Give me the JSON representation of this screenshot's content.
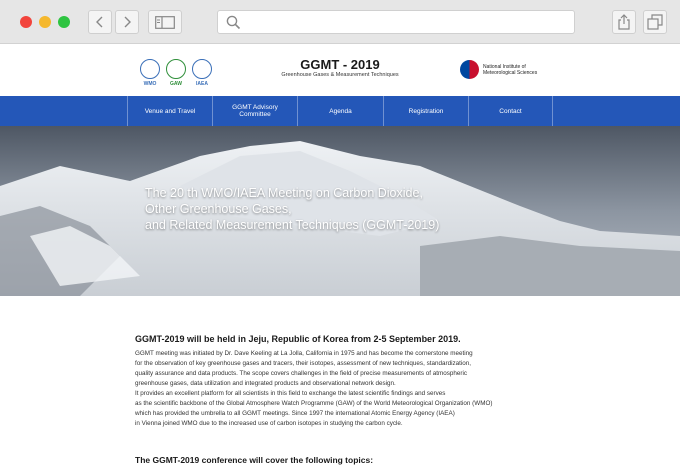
{
  "browser": {
    "icons": [
      "back-icon",
      "forward-icon",
      "sidebar-icon",
      "search-icon",
      "share-icon",
      "tabs-icon"
    ]
  },
  "header": {
    "logos": [
      "WMO",
      "GAW",
      "IAEA"
    ],
    "title": "GGMT - 2019",
    "subtitle": "Greenhouse Gases & Measurement Techniques",
    "institute_line1": "National Institute of",
    "institute_line2": "Meteorological Sciences"
  },
  "nav": {
    "venue": "Venue and Travel",
    "committee_line1": "GGMT Advisory",
    "committee_line2": "Committee",
    "agenda": "Agenda",
    "registration": "Registration",
    "contact": "Contact",
    "bar_color": "#2457b8"
  },
  "hero": {
    "line1": "The 20 th WMO/IAEA Meeting on Carbon Dioxide,",
    "line2": "Other Greenhouse Gases,",
    "line3": "and Related Measurement Techniques (GGMT-2019)"
  },
  "content": {
    "headline": "GGMT-2019 will be held in Jeju, Republic of Korea from 2-5 September 2019.",
    "lines": [
      "GGMT meeting was initiated by Dr. Dave Keeling at La Jolla, California in 1975 and has become the cornerstone meeting",
      "for the observation of key greenhouse gases and tracers, their isotopes, assessment of new techniques, standardization,",
      "quality assurance and data products. The scope covers challenges in the field of precise measurements of atmospheric",
      "greenhouse gases, data utilization and integrated products and observational network design.",
      "It provides an excellent platform for all scientists in this field to exchange the latest scientific findings and serves",
      "as the scientific backbone of the Global Atmosphere Watch Programme (GAW) of the World Meteorological Organization (WMO)",
      " which has provided the umbrella to all GGMT meetings. Since 1997 the international Atomic Energy Agency (IAEA)",
      "in Vienna joined WMO due to the increased use of carbon isotopes in studying the carbon cycle."
    ],
    "topics_heading": "The GGMT-2019 conference will cover the following topics:"
  }
}
